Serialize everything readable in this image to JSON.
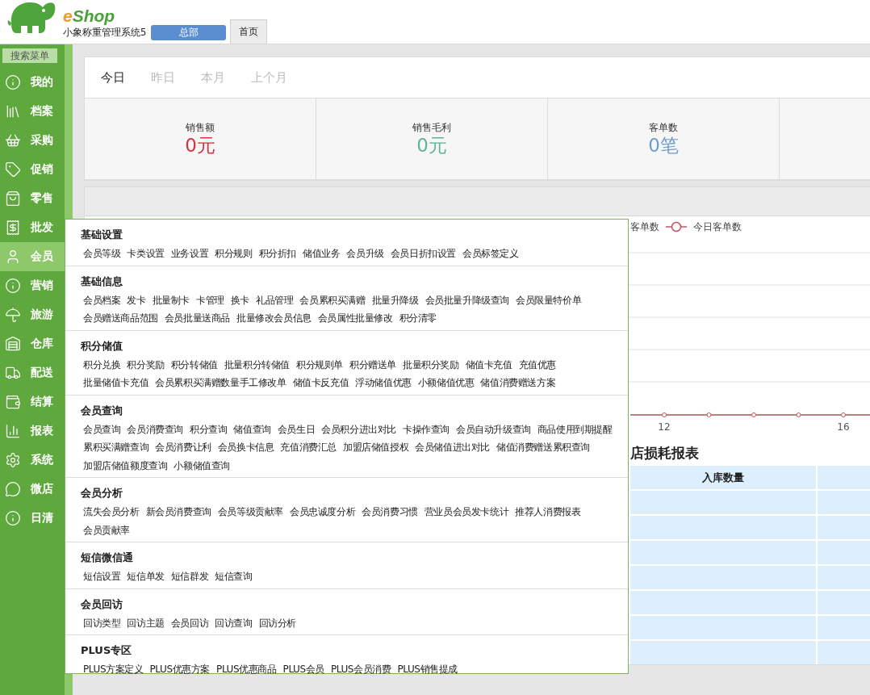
{
  "brand": {
    "accent": "e",
    "name": "Shop",
    "subtitle": "小象称重管理系统5"
  },
  "org_button": "总部",
  "tabs": [
    {
      "label": "首页",
      "selected": true
    }
  ],
  "sidebar": {
    "search": "搜索菜单",
    "items": [
      {
        "label": "我的",
        "selected": false
      },
      {
        "label": "档案",
        "selected": false
      },
      {
        "label": "采购",
        "selected": false
      },
      {
        "label": "促销",
        "selected": false
      },
      {
        "label": "零售",
        "selected": false
      },
      {
        "label": "批发",
        "selected": false
      },
      {
        "label": "会员",
        "selected": true
      },
      {
        "label": "营销",
        "selected": false
      },
      {
        "label": "旅游",
        "selected": false
      },
      {
        "label": "仓库",
        "selected": false
      },
      {
        "label": "配送",
        "selected": false
      },
      {
        "label": "结算",
        "selected": false
      },
      {
        "label": "报表",
        "selected": false
      },
      {
        "label": "系统",
        "selected": false
      },
      {
        "label": "微店",
        "selected": false
      },
      {
        "label": "日清",
        "selected": false
      }
    ]
  },
  "periods": [
    {
      "label": "今日",
      "selected": true
    },
    {
      "label": "昨日",
      "selected": false
    },
    {
      "label": "本月",
      "selected": false
    },
    {
      "label": "上个月",
      "selected": false
    }
  ],
  "stats": [
    {
      "label": "销售额",
      "value": "0元",
      "color": "#d6323d"
    },
    {
      "label": "销售毛利",
      "value": "0元",
      "color": "#5fb39b"
    },
    {
      "label": "客单数",
      "value": "0笔",
      "color": "#6f9ccc"
    }
  ],
  "chart": {
    "legend": [
      {
        "label": "客单数",
        "kind": "plain"
      },
      {
        "label": "今日客单数",
        "kind": "marker"
      }
    ],
    "x_labels": [
      "12",
      "16"
    ]
  },
  "report": {
    "title": "店损耗报表",
    "columns": [
      "入库数量"
    ]
  },
  "member_menu": {
    "sections": [
      {
        "title": "基础设置",
        "items": [
          "会员等级",
          "卡类设置",
          "业务设置",
          "积分规则",
          "积分折扣",
          "储值业务",
          "会员升级",
          "会员日折扣设置",
          "会员标签定义"
        ]
      },
      {
        "title": "基础信息",
        "items": [
          "会员档案",
          "发卡",
          "批量制卡",
          "卡管理",
          "换卡",
          "礼品管理",
          "会员累积买满赠",
          "批量升降级",
          "会员批量升降级查询",
          "会员限量特价单",
          "会员赠送商品范围",
          "会员批量送商品",
          "批量修改会员信息",
          "会员属性批量修改",
          "积分清零"
        ]
      },
      {
        "title": "积分储值",
        "items": [
          "积分兑换",
          "积分奖励",
          "积分转储值",
          "批量积分转储值",
          "积分规则单",
          "积分赠送单",
          "批量积分奖励",
          "储值卡充值",
          "充值优惠",
          "批量储值卡充值",
          "会员累积买满赠数量手工修改单",
          "储值卡反充值",
          "浮动储值优惠",
          "小额储值优惠",
          "储值消费赠送方案"
        ]
      },
      {
        "title": "会员查询",
        "items": [
          "会员查询",
          "会员消费查询",
          "积分查询",
          "储值查询",
          "会员生日",
          "会员积分进出对比",
          "卡操作查询",
          "会员自动升级查询",
          "商品使用到期提醒",
          "累积买满赠查询",
          "会员消费让利",
          "会员换卡信息",
          "充值消费汇总",
          "加盟店储值授权",
          "会员储值进出对比",
          "储值消费赠送累积查询",
          "加盟店储值额度查询",
          "小额储值查询"
        ]
      },
      {
        "title": "会员分析",
        "items": [
          "流失会员分析",
          "新会员消费查询",
          "会员等级贡献率",
          "会员忠诚度分析",
          "会员消费习惯",
          "营业员会员发卡统计",
          "推荐人消费报表",
          "会员贡献率"
        ]
      },
      {
        "title": "短信微信通",
        "items": [
          "短信设置",
          "短信单发",
          "短信群发",
          "短信查询"
        ]
      },
      {
        "title": "会员回访",
        "items": [
          "回访类型",
          "回访主题",
          "会员回访",
          "回访查询",
          "回访分析"
        ]
      },
      {
        "title": "PLUS专区",
        "items": [
          "PLUS方案定义",
          "PLUS优惠方案",
          "PLUS优惠商品",
          "PLUS会员",
          "PLUS会员消费",
          "PLUS销售提成"
        ]
      }
    ]
  }
}
